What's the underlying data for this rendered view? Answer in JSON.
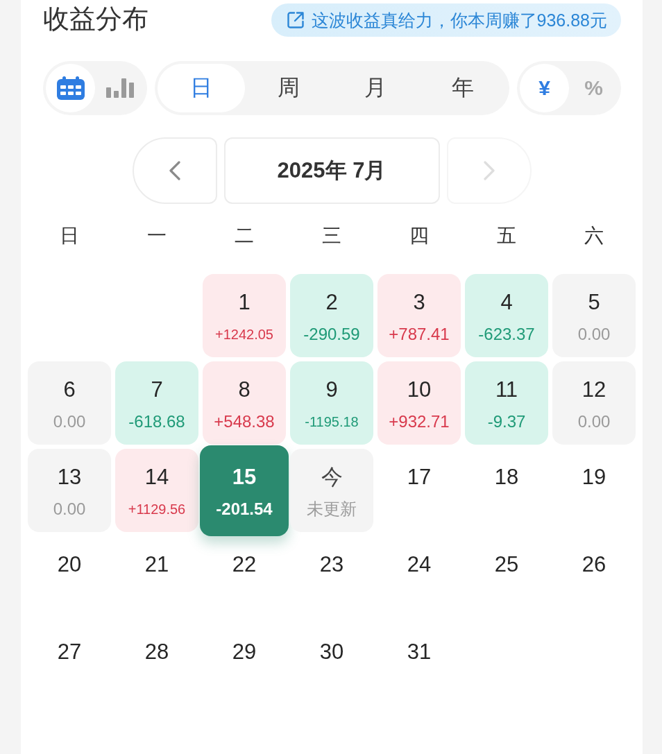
{
  "header": {
    "title": "收益分布",
    "banner": "这波收益真给力，你本周赚了936.88元"
  },
  "view_modes": [
    {
      "kind": "calendar",
      "selected": true
    },
    {
      "kind": "chart",
      "selected": false
    }
  ],
  "periods": [
    {
      "label": "日",
      "selected": true
    },
    {
      "label": "周",
      "selected": false
    },
    {
      "label": "月",
      "selected": false
    },
    {
      "label": "年",
      "selected": false
    }
  ],
  "units": [
    {
      "label": "¥",
      "selected": true
    },
    {
      "label": "%",
      "selected": false
    }
  ],
  "calendar": {
    "prev": {
      "disabled": false
    },
    "month": "2025年 7月",
    "next": {
      "disabled": true
    },
    "weekdays": [
      "日",
      "一",
      "二",
      "三",
      "四",
      "五",
      "六"
    ],
    "weeks": [
      [
        {
          "day": "1",
          "value": "+1242.05",
          "kind": "gain",
          "selected": false
        },
        {
          "day": "2",
          "value": "-290.59",
          "kind": "loss",
          "selected": false
        },
        {
          "day": "3",
          "value": "+787.41",
          "kind": "gain",
          "selected": false
        },
        {
          "day": "4",
          "value": "-623.37",
          "kind": "loss",
          "selected": false
        },
        {
          "day": "5",
          "value": "0.00",
          "kind": "zero",
          "selected": false
        }
      ],
      [
        {
          "day": "6",
          "value": "0.00",
          "kind": "zero",
          "selected": false
        },
        {
          "day": "7",
          "value": "-618.68",
          "kind": "loss",
          "selected": false
        },
        {
          "day": "8",
          "value": "+548.38",
          "kind": "gain",
          "selected": false
        },
        {
          "day": "9",
          "value": "-1195.18",
          "kind": "loss",
          "selected": false
        },
        {
          "day": "10",
          "value": "+932.71",
          "kind": "gain",
          "selected": false
        },
        {
          "day": "11",
          "value": "-9.37",
          "kind": "loss",
          "selected": false
        },
        {
          "day": "12",
          "value": "0.00",
          "kind": "zero",
          "selected": false
        }
      ],
      [
        {
          "day": "13",
          "value": "0.00",
          "kind": "zero",
          "selected": false
        },
        {
          "day": "14",
          "value": "+1129.56",
          "kind": "gain",
          "selected": false
        },
        {
          "day": "15",
          "value": "-201.54",
          "kind": "loss",
          "selected": true
        },
        {
          "day": "今",
          "value": "未更新",
          "kind": "today",
          "selected": false
        },
        {
          "day": "17",
          "kind": "future",
          "selected": false
        },
        {
          "day": "18",
          "kind": "future",
          "selected": false
        },
        {
          "day": "19",
          "kind": "future",
          "selected": false
        }
      ],
      [
        {
          "day": "20",
          "kind": "future",
          "selected": false
        },
        {
          "day": "21",
          "kind": "future",
          "selected": false
        },
        {
          "day": "22",
          "kind": "future",
          "selected": false
        },
        {
          "day": "23",
          "kind": "future",
          "selected": false
        },
        {
          "day": "24",
          "kind": "future",
          "selected": false
        },
        {
          "day": "25",
          "kind": "future",
          "selected": false
        },
        {
          "day": "26",
          "kind": "future",
          "selected": false
        }
      ],
      [
        {
          "day": "27",
          "kind": "future",
          "selected": false
        },
        {
          "day": "28",
          "kind": "future",
          "selected": false
        },
        {
          "day": "29",
          "kind": "future",
          "selected": false
        },
        {
          "day": "30",
          "kind": "future",
          "selected": false
        },
        {
          "day": "31",
          "kind": "future",
          "selected": false
        }
      ]
    ]
  }
}
